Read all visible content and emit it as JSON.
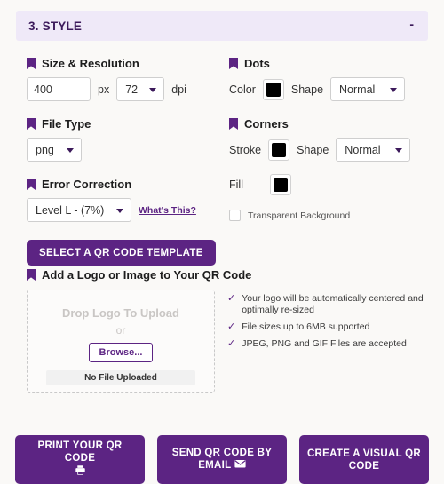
{
  "section": {
    "title": "3. STYLE",
    "collapse_label": "-"
  },
  "size_resolution": {
    "heading": "Size & Resolution",
    "size_value": "400",
    "size_placeholder": "400",
    "unit_px": "px",
    "dpi_value": "72",
    "unit_dpi": "dpi"
  },
  "file_type": {
    "heading": "File Type",
    "value": "png"
  },
  "error_correction": {
    "heading": "Error Correction",
    "value": "Level L - (7%)",
    "help_link": "What's This?"
  },
  "template_button": {
    "label": "SELECT A QR CODE TEMPLATE"
  },
  "dots": {
    "heading": "Dots",
    "color_label": "Color",
    "color_value": "#000000",
    "shape_label": "Shape",
    "shape_value": "Normal"
  },
  "corners": {
    "heading": "Corners",
    "stroke_label": "Stroke",
    "stroke_value": "#000000",
    "shape_label": "Shape",
    "shape_value": "Normal",
    "fill_label": "Fill",
    "fill_value": "#000000"
  },
  "transparent": {
    "label": "Transparent Background",
    "checked": false
  },
  "logo": {
    "heading": "Add a Logo or Image to Your QR Code",
    "drop_text": "Drop Logo To Upload",
    "or_text": "or",
    "browse_label": "Browse...",
    "no_file_label": "No File Uploaded"
  },
  "features": [
    "Your logo will be automatically centered and optimally re-sized",
    "File sizes up to 6MB supported",
    "JPEG, PNG and GIF Files are accepted"
  ],
  "footer": {
    "print_label": "PRINT YOUR QR CODE",
    "email_label": "SEND QR CODE BY EMAIL",
    "visual_label": "CREATE A VISUAL QR CODE"
  },
  "colors": {
    "brand_purple": "#5c2483",
    "header_bg": "#efe9f8",
    "page_bg": "#faf9f7"
  }
}
